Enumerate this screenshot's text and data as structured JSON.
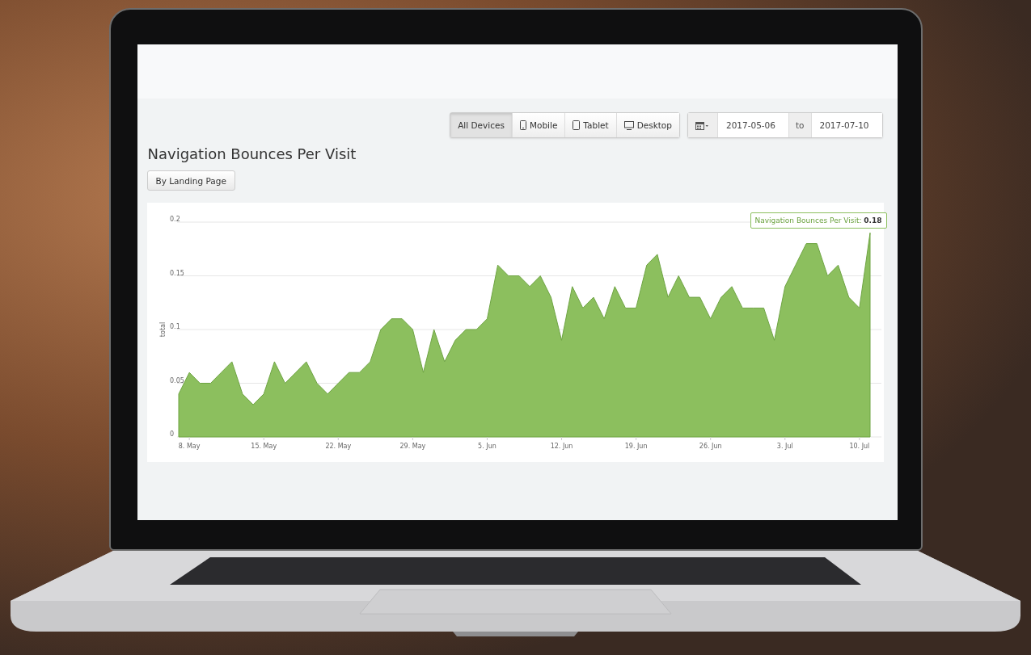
{
  "device_filter": [
    {
      "label": "All Devices",
      "kind": "text",
      "selected": true
    },
    {
      "label": "Mobile",
      "kind": "phone",
      "selected": false
    },
    {
      "label": "Tablet",
      "kind": "tablet",
      "selected": false
    },
    {
      "label": "Desktop",
      "kind": "monitor",
      "selected": false
    }
  ],
  "date_range": {
    "from": "2017-05-06",
    "separator": "to",
    "to": "2017-07-10"
  },
  "title": "Navigation Bounces Per Visit",
  "group_button": "By Landing Page",
  "chart": {
    "tooltip": "Navigation Bounces Per Visit: **0.18**",
    "chart_data": {
      "type": "area",
      "ylabel": "total",
      "grid": true,
      "categories": [
        null,
        "8. May",
        null,
        null,
        null,
        null,
        null,
        null,
        "15. May",
        null,
        null,
        null,
        null,
        null,
        null,
        "22. May",
        null,
        null,
        null,
        null,
        null,
        null,
        "29. May",
        null,
        null,
        null,
        null,
        null,
        null,
        "5. Jun",
        null,
        null,
        null,
        null,
        null,
        null,
        "12. Jun",
        null,
        null,
        null,
        null,
        null,
        null,
        "19. Jun",
        null,
        null,
        null,
        null,
        null,
        null,
        "26. Jun",
        null,
        null,
        null,
        null,
        null,
        null,
        "3. Jul",
        null,
        null,
        null,
        null,
        null,
        null,
        "10. Jul",
        null
      ],
      "ylim": [
        0,
        0.2
      ],
      "yticks": [
        0,
        0.05,
        0.1,
        0.15,
        0.2
      ],
      "series": [
        {
          "color": "#8cbf5e",
          "values": [
            0.04,
            0.06,
            0.05,
            0.05,
            0.06,
            0.07,
            0.04,
            0.03,
            0.04,
            0.07,
            0.05,
            0.06,
            0.07,
            0.05,
            0.04,
            0.05,
            0.06,
            0.06,
            0.07,
            0.1,
            0.11,
            0.11,
            0.1,
            0.06,
            0.1,
            0.07,
            0.09,
            0.1,
            0.1,
            0.11,
            0.16,
            0.15,
            0.15,
            0.14,
            0.15,
            0.13,
            0.09,
            0.14,
            0.12,
            0.13,
            0.11,
            0.14,
            0.12,
            0.12,
            0.16,
            0.17,
            0.13,
            0.15,
            0.13,
            0.13,
            0.11,
            0.13,
            0.14,
            0.12,
            0.12,
            0.12,
            0.09,
            0.14,
            0.16,
            0.18,
            0.18,
            0.15,
            0.16,
            0.13,
            0.12,
            0.19
          ]
        }
      ]
    }
  }
}
